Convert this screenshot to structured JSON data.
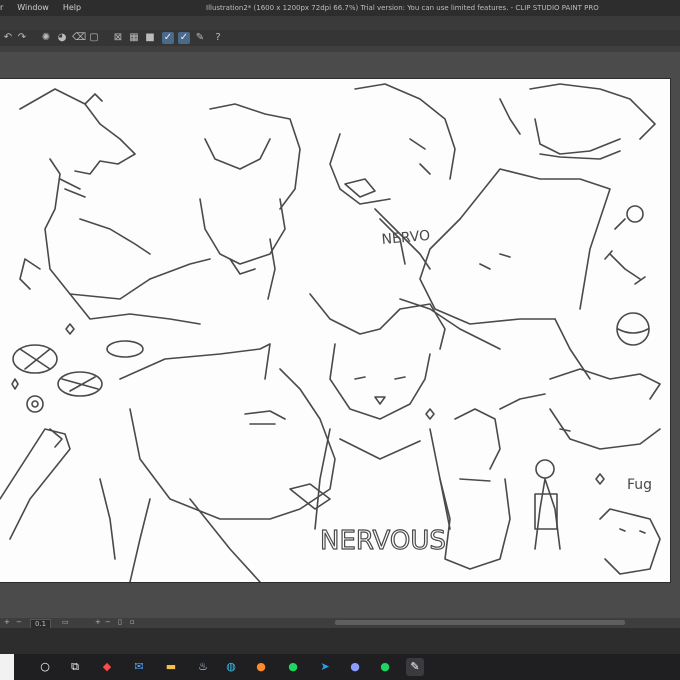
{
  "app": {
    "title": "Illustration2* (1600 x 1200px 72dpi 66.7%)  Trial version: You can use limited features. - CLIP STUDIO PAINT PRO"
  },
  "menu": {
    "items": [
      "r",
      "Window",
      "Help"
    ]
  },
  "toolbar": {
    "icons": [
      "undo-icon",
      "redo-icon",
      "brush-icon",
      "fill-icon",
      "eraser-icon",
      "select-icon",
      "transform-icon",
      "ruler-icon",
      "check-a-icon",
      "check-b-icon",
      "pen-icon",
      "help-icon"
    ]
  },
  "status": {
    "zoom": "0.1"
  },
  "canvas": {
    "doodle_text": [
      "NERVO",
      "NERVOUS",
      "Fug"
    ]
  },
  "taskbar": {
    "apps": [
      "search",
      "task-view",
      "app-red",
      "mail",
      "files",
      "steam",
      "edge",
      "firefox",
      "spotify",
      "telegram",
      "discord",
      "spotify-2",
      "clip-studio"
    ],
    "accent": "#ff6a00"
  }
}
